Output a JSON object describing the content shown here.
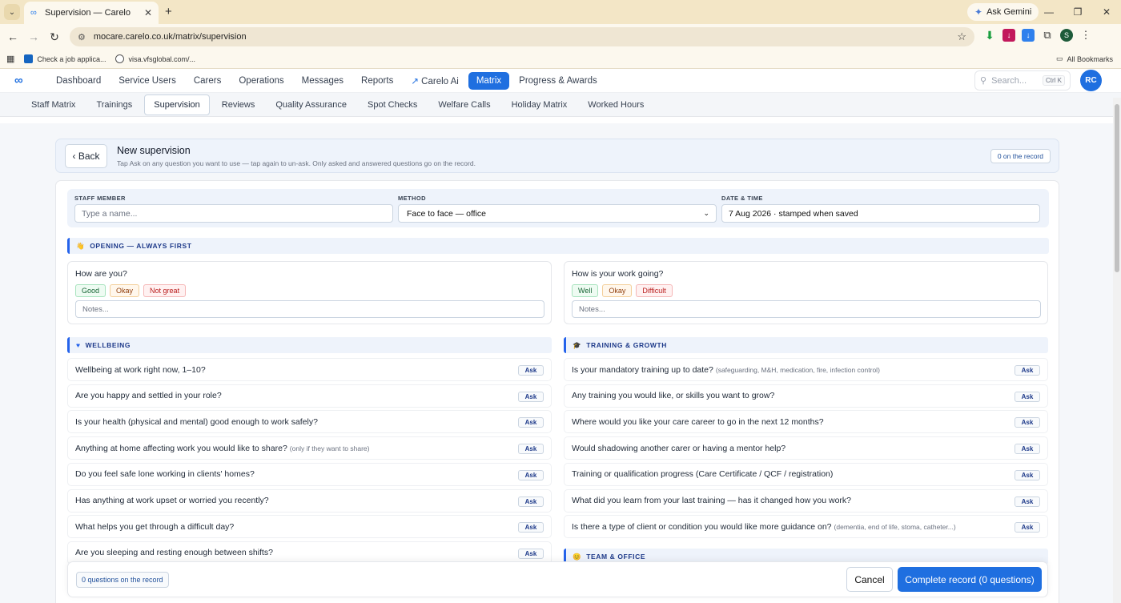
{
  "browser": {
    "tab_title": "Supervision — Carelo",
    "gemini_label": "Ask Gemini",
    "url": "mocare.carelo.co.uk/matrix/supervision",
    "profile_initial": "S",
    "bookmarks": [
      {
        "label": "Check a job applica..."
      },
      {
        "label": "visa.vfsglobal.com/..."
      }
    ],
    "all_bookmarks": "All Bookmarks"
  },
  "app": {
    "nav": [
      {
        "label": "Dashboard"
      },
      {
        "label": "Service Users"
      },
      {
        "label": "Carers"
      },
      {
        "label": "Operations"
      },
      {
        "label": "Messages"
      },
      {
        "label": "Reports"
      },
      {
        "label": "Carelo Ai"
      },
      {
        "label": "Matrix"
      },
      {
        "label": "Progress & Awards"
      }
    ],
    "search_placeholder": "Search...",
    "search_shortcut": "Ctrl K",
    "user_initials": "RC",
    "subnav": [
      {
        "label": "Staff Matrix"
      },
      {
        "label": "Trainings"
      },
      {
        "label": "Supervision"
      },
      {
        "label": "Reviews"
      },
      {
        "label": "Quality Assurance"
      },
      {
        "label": "Spot Checks"
      },
      {
        "label": "Welfare Calls"
      },
      {
        "label": "Holiday Matrix"
      },
      {
        "label": "Worked Hours"
      }
    ]
  },
  "header": {
    "back_label": "‹ Back",
    "title": "New supervision",
    "subtitle": "Tap Ask on any question you want to use — tap again to un-ask. Only asked and answered questions go on the record.",
    "on_record": "0 on the record"
  },
  "fields": {
    "staff_label": "STAFF MEMBER",
    "staff_placeholder": "Type a name...",
    "method_label": "METHOD",
    "method_value": "Face to face — office",
    "datetime_label": "DATE & TIME",
    "datetime_value": "7 Aug 2026 · stamped when saved"
  },
  "opening": {
    "section_label": "OPENING — ALWAYS FIRST",
    "cards": [
      {
        "question": "How are you?",
        "options": [
          "Good",
          "Okay",
          "Not great"
        ],
        "notes_placeholder": "Notes..."
      },
      {
        "question": "How is your work going?",
        "options": [
          "Well",
          "Okay",
          "Difficult"
        ],
        "notes_placeholder": "Notes..."
      }
    ]
  },
  "wellbeing": {
    "section_label": "WELLBEING",
    "questions": [
      {
        "text": "Wellbeing at work right now, 1–10?",
        "hint": ""
      },
      {
        "text": "Are you happy and settled in your role?",
        "hint": ""
      },
      {
        "text": "Is your health (physical and mental) good enough to work safely?",
        "hint": ""
      },
      {
        "text": "Anything at home affecting work you would like to share?",
        "hint": "(only if they want to share)"
      },
      {
        "text": "Do you feel safe lone working in clients' homes?",
        "hint": ""
      },
      {
        "text": "Has anything at work upset or worried you recently?",
        "hint": ""
      },
      {
        "text": "What helps you get through a difficult day?",
        "hint": ""
      },
      {
        "text": "Are you sleeping and resting enough between shifts?",
        "hint": ""
      }
    ]
  },
  "training": {
    "section_label": "TRAINING & GROWTH",
    "questions": [
      {
        "text": "Is your mandatory training up to date?",
        "hint": "(safeguarding, M&H, medication, fire, infection control)"
      },
      {
        "text": "Any training you would like, or skills you want to grow?",
        "hint": ""
      },
      {
        "text": "Where would you like your care career to go in the next 12 months?",
        "hint": ""
      },
      {
        "text": "Would shadowing another carer or having a mentor help?",
        "hint": ""
      },
      {
        "text": "Training or qualification progress (Care Certificate / QCF / registration)",
        "hint": ""
      },
      {
        "text": "What did you learn from your last training — has it changed how you work?",
        "hint": ""
      },
      {
        "text": "Is there a type of client or condition you would like more guidance on?",
        "hint": "(dementia, end of life, stoma, catheter...)"
      }
    ]
  },
  "team": {
    "section_label": "TEAM & OFFICE"
  },
  "ask_label": "Ask",
  "footer": {
    "count_label": "0 questions on the record",
    "cancel_label": "Cancel",
    "complete_label": "Complete record (0 questions)"
  }
}
